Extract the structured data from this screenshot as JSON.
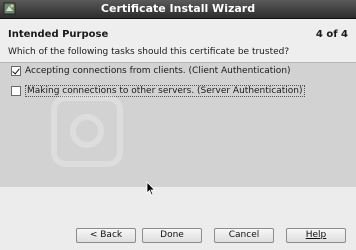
{
  "window": {
    "title": "Certificate Install Wizard",
    "app_icon": "certificate-icon"
  },
  "header": {
    "section": "Intended Purpose",
    "step": "4 of 4",
    "question": "Which of the following tasks should this certificate be trusted?"
  },
  "options": [
    {
      "label": "Accepting connections from clients.  (Client Authentication)",
      "checked": true
    },
    {
      "label": "Making connections to other servers. (Server Authentication)",
      "checked": false
    }
  ],
  "buttons": {
    "back": "< Back",
    "done": "Done",
    "cancel": "Cancel",
    "help": "Help"
  }
}
